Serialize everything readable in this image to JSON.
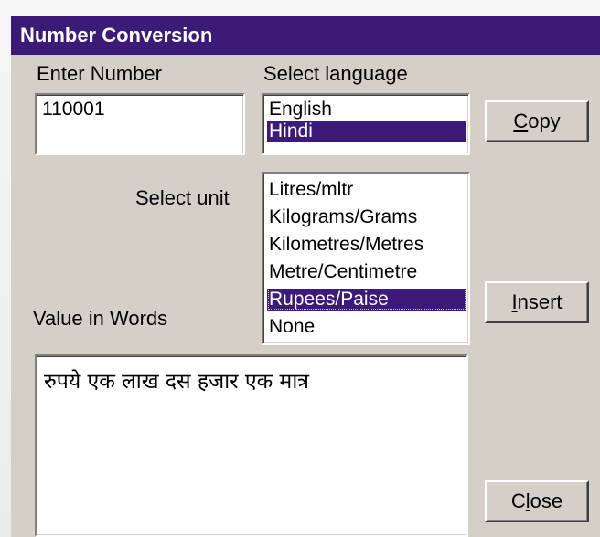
{
  "window": {
    "title": "Number Conversion"
  },
  "labels": {
    "enter_number": "Enter Number",
    "select_language": "Select language",
    "select_unit": "Select unit",
    "value_in_words": "Value in Words"
  },
  "number_input": {
    "value": "110001"
  },
  "language_list": {
    "items": [
      "English",
      "Hindi"
    ],
    "selected": "Hindi"
  },
  "unit_list": {
    "items": [
      "Litres/mltr",
      "Kilograms/Grams",
      "Kilometres/Metres",
      "Metre/Centimetre",
      "Rupees/Paise",
      "None"
    ],
    "selected": "Rupees/Paise"
  },
  "words_output": {
    "value": "रुपये एक लाख दस हजार एक मात्र"
  },
  "buttons": {
    "copy": {
      "accel": "C",
      "rest": "opy"
    },
    "insert": {
      "accel": "I",
      "rest": "nsert"
    },
    "close": {
      "pre": "C",
      "accel": "l",
      "rest": "ose"
    }
  },
  "colors": {
    "accent": "#3c1a78",
    "dialog_bg": "#d4d0c8"
  }
}
